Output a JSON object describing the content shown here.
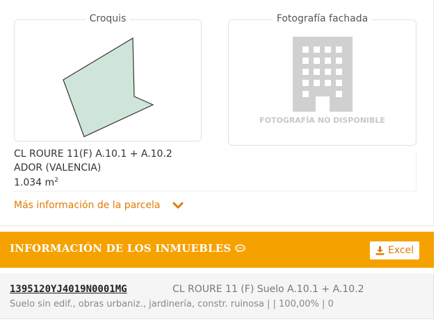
{
  "croquis": {
    "legend": "Croquis"
  },
  "fachada": {
    "legend": "Fotografía fachada",
    "unavailable_text": "FOTOGRAFÍA NO DISPONIBLE"
  },
  "parcel": {
    "address_line1": "CL ROURE 11(F) A.10.1 + A.10.2",
    "address_line2": "ADOR (VALENCIA)",
    "area_value": "1.034 m",
    "area_exp": "2"
  },
  "more_info_link": "Más información de la parcela",
  "inmuebles": {
    "title": "INFORMACIÓN DE LOS INMUEBLES",
    "excel_label": "Excel",
    "accent_color": "#f5a200"
  },
  "item": {
    "reference": "1395120YJ4019N0001MG",
    "address": "CL ROURE 11 (F) Suelo A.10.1 + A.10.2",
    "description": "Suelo sin edif., obras urbaniz., jardinería, constr. ruinosa | | 100,00% | 0"
  },
  "icons": [
    "building-icon",
    "chevron-down-icon",
    "chat-bubble-icon",
    "download-icon"
  ]
}
